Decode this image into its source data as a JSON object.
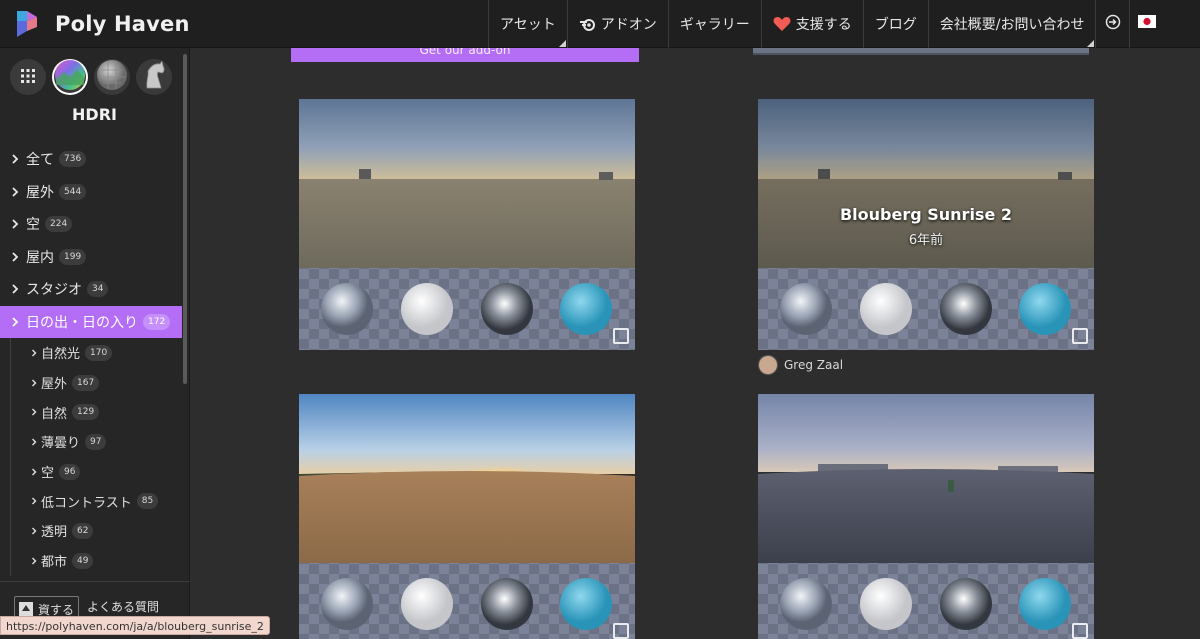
{
  "header": {
    "title": "Poly Haven",
    "nav": [
      {
        "label": "アセット",
        "icon": "",
        "dropdown": true
      },
      {
        "label": "アドオン",
        "icon": "blender-icon",
        "dropdown": false
      },
      {
        "label": "ギャラリー",
        "icon": "",
        "dropdown": false
      },
      {
        "label": "支援する",
        "icon": "heart-icon",
        "dropdown": false
      },
      {
        "label": "ブログ",
        "icon": "",
        "dropdown": false
      },
      {
        "label": "会社概要/お問い合わせ",
        "icon": "",
        "dropdown": true
      }
    ]
  },
  "sidebar": {
    "title": "HDRI",
    "categories": [
      {
        "label": "全て",
        "count": "736"
      },
      {
        "label": "屋外",
        "count": "544"
      },
      {
        "label": "空",
        "count": "224"
      },
      {
        "label": "屋内",
        "count": "199"
      },
      {
        "label": "スタジオ",
        "count": "34"
      },
      {
        "label": "日の出・日の入り",
        "count": "172",
        "active": true
      }
    ],
    "subcategories": [
      {
        "label": "自然光",
        "count": "170"
      },
      {
        "label": "屋外",
        "count": "167"
      },
      {
        "label": "自然",
        "count": "129"
      },
      {
        "label": "薄曇り",
        "count": "97"
      },
      {
        "label": "空",
        "count": "96"
      },
      {
        "label": "低コントラスト",
        "count": "85"
      },
      {
        "label": "透明",
        "count": "62"
      },
      {
        "label": "都市",
        "count": "49"
      }
    ],
    "vote_label": "資する",
    "faq_label": "よくある質問"
  },
  "main": {
    "promo_label": "Get our add-on",
    "cards": [
      {
        "title": "",
        "age": ""
      },
      {
        "title": "Blouberg Sunrise 2",
        "age": "6年前",
        "author": "Greg Zaal"
      },
      {
        "title": "",
        "age": ""
      },
      {
        "title": "",
        "age": ""
      }
    ]
  },
  "status_url": "https://polyhaven.com/ja/a/blouberg_sunrise_2",
  "colors": {
    "accent": "#b46ef5",
    "header_bg": "#1f1f1f",
    "sidebar_bg": "#262626",
    "main_bg": "#2d2d2d"
  }
}
